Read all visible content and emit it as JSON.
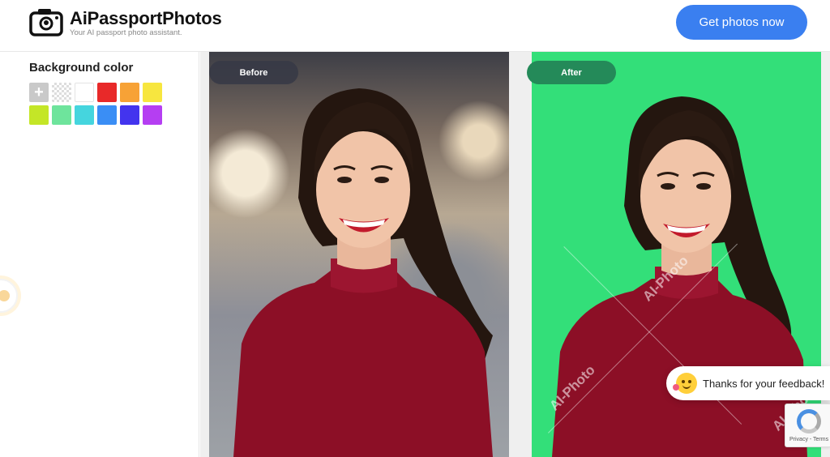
{
  "header": {
    "brand": "AiPassportPhotos",
    "tagline": "Your AI passport photo assistant.",
    "cta_label": "Get photos now"
  },
  "sidebar": {
    "bg_title": "Background color",
    "swatches": [
      {
        "name": "add",
        "color": "#c9c9c9",
        "label": "+"
      },
      {
        "name": "transparent",
        "color": "transparent"
      },
      {
        "name": "white",
        "color": "#ffffff"
      },
      {
        "name": "red",
        "color": "#e82929"
      },
      {
        "name": "orange",
        "color": "#f7a236"
      },
      {
        "name": "yellow",
        "color": "#f7e63f"
      },
      {
        "name": "lime",
        "color": "#c4e627"
      },
      {
        "name": "mint",
        "color": "#6ee49c"
      },
      {
        "name": "cyan",
        "color": "#45d5de"
      },
      {
        "name": "blue",
        "color": "#3a8ef5"
      },
      {
        "name": "indigo",
        "color": "#4334ee"
      },
      {
        "name": "purple",
        "color": "#b53ef2"
      }
    ]
  },
  "preview": {
    "before_label": "Before",
    "after_label": "After",
    "after_bg_color": "#33df79",
    "watermark": "AI-Photo"
  },
  "toast": {
    "text": "Thanks for your feedback!"
  },
  "recaptcha": {
    "links": "Privacy - Terms"
  }
}
